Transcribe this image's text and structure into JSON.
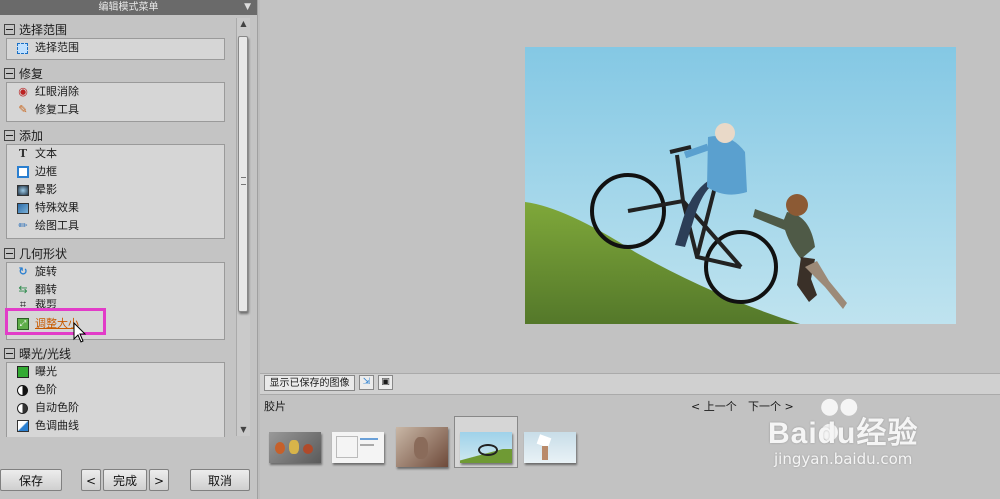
{
  "panel": {
    "title": "编辑模式菜单"
  },
  "sections": [
    {
      "title": "选择范围",
      "items": [
        {
          "label": "选择范围",
          "icon": "selection-icon"
        }
      ]
    },
    {
      "title": "修复",
      "items": [
        {
          "label": "红眼消除",
          "icon": "eye-icon"
        },
        {
          "label": "修复工具",
          "icon": "wrench-icon"
        }
      ]
    },
    {
      "title": "添加",
      "items": [
        {
          "label": "文本",
          "icon": "text-icon"
        },
        {
          "label": "边框",
          "icon": "frame-icon"
        },
        {
          "label": "晕影",
          "icon": "vignette-icon"
        },
        {
          "label": "特殊效果",
          "icon": "effects-icon"
        },
        {
          "label": "绘图工具",
          "icon": "brush-icon"
        }
      ]
    },
    {
      "title": "几何形状",
      "items": [
        {
          "label": "旋转",
          "icon": "rotate-icon"
        },
        {
          "label": "翻转",
          "icon": "flip-icon"
        },
        {
          "label": "裁剪",
          "icon": "crop-icon"
        },
        {
          "label": "调整大小",
          "icon": "resize-icon"
        }
      ]
    },
    {
      "title": "曝光/光线",
      "items": [
        {
          "label": "曝光",
          "icon": "exposure-icon"
        },
        {
          "label": "色阶",
          "icon": "levels-icon"
        },
        {
          "label": "自动色阶",
          "icon": "auto-levels-icon"
        },
        {
          "label": "色调曲线",
          "icon": "curves-icon"
        }
      ]
    }
  ],
  "buttons": {
    "save": "保存",
    "prev": "<",
    "done": "完成",
    "next": ">",
    "cancel": "取消"
  },
  "filmstrip": {
    "show_saved": "显示已保存的图像",
    "label": "胶片",
    "prev": "< 上一个",
    "next": "下一个 >",
    "thumb_count": 5,
    "selected_index": 3
  },
  "watermark": {
    "brand": "Baidu经验",
    "url": "jingyan.baidu.com"
  },
  "colors": {
    "highlight": "#e23cc8",
    "active_text": "#c85a00"
  }
}
